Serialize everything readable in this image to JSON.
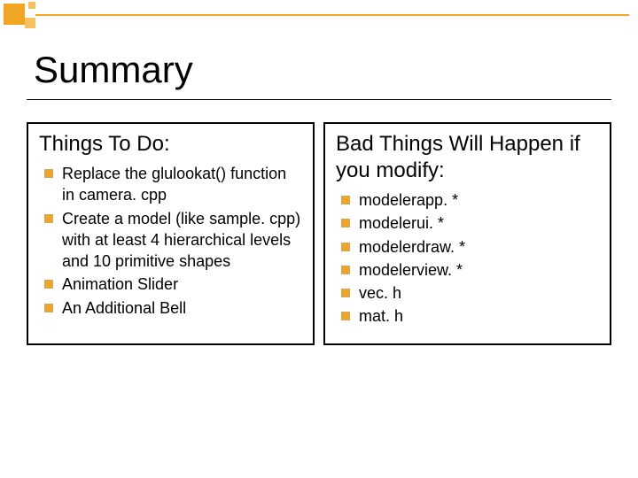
{
  "title": "Summary",
  "left": {
    "heading": "Things To Do:",
    "items": [
      "Replace the glulookat() function in camera. cpp",
      "Create a model (like sample. cpp) with at least 4 hierarchical levels and 10 primitive shapes",
      "Animation Slider",
      "An Additional Bell"
    ]
  },
  "right": {
    "heading": "Bad Things Will Happen if you modify:",
    "items": [
      "modelerapp. *",
      "modelerui. *",
      "modelerdraw. *",
      "modelerview. *",
      "vec. h",
      "mat. h"
    ]
  }
}
